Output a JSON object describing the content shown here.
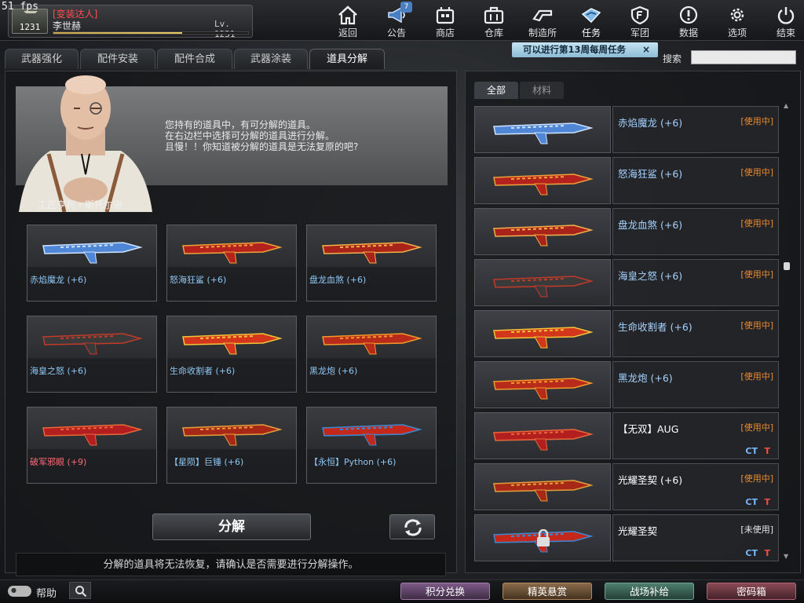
{
  "fps": "51 fps",
  "profile": {
    "rank": "1231",
    "title": "[变装达人]",
    "name": "李世赫",
    "level": "Lv. 1231",
    "xp_fraction": 0.66
  },
  "nav": [
    {
      "label": "返回",
      "icon": "home-icon"
    },
    {
      "label": "公告",
      "icon": "megaphone-icon",
      "badge": "7"
    },
    {
      "label": "商店",
      "icon": "shop-icon"
    },
    {
      "label": "仓库",
      "icon": "briefcase-icon"
    },
    {
      "label": "制造所",
      "icon": "wrench-icon"
    },
    {
      "label": "任务",
      "icon": "mission-icon"
    },
    {
      "label": "军团",
      "icon": "shield-icon"
    },
    {
      "label": "数据",
      "icon": "info-icon"
    },
    {
      "label": "选项",
      "icon": "gear-icon"
    },
    {
      "label": "结束",
      "icon": "power-icon"
    }
  ],
  "weekly_notice": "可以进行第13周每周任务",
  "weekly_close": "×",
  "search_label": "搜索",
  "search_value": "",
  "tabs": [
    "武器强化",
    "配件安装",
    "配件合成",
    "武器涂装",
    "道具分解"
  ],
  "npc": {
    "name": "工匠亨利・斯托尔诺",
    "lines": [
      "您持有的道具中，有可分解的道具。",
      "在右边栏中选择可分解的道具进行分解。",
      "且慢！！你知道被分解的道具是无法复原的吧?"
    ]
  },
  "selected_items": [
    {
      "name": "赤焰魔龙 (+6)",
      "color": "#8fc7f3"
    },
    {
      "name": "怒海狂鲨 (+6)",
      "color": "#8fc7f3"
    },
    {
      "name": "盘龙血煞 (+6)",
      "color": "#8fc7f3"
    },
    {
      "name": "海皇之怒 (+6)",
      "color": "#8fc7f3"
    },
    {
      "name": "生命收割者 (+6)",
      "color": "#8fc7f3"
    },
    {
      "name": "黑龙炮 (+6)",
      "color": "#8fc7f3"
    },
    {
      "name": "破军邪眼 (+9)",
      "color": "#ff6a7a"
    },
    {
      "name": "【星陨】巨锤 (+6)",
      "color": "#8fc7f3"
    },
    {
      "name": "【永恒】Python (+6)",
      "color": "#8fc7f3"
    }
  ],
  "decompose_label": "分解",
  "warning": "分解的道具将无法恢复，请确认是否需要进行分解操作。",
  "right_tabs": [
    "全部",
    "材料"
  ],
  "inventory": [
    {
      "name": "赤焰魔龙 (+6)",
      "status": "[使用中]"
    },
    {
      "name": "怒海狂鲨 (+6)",
      "status": "[使用中]"
    },
    {
      "name": "盘龙血煞 (+6)",
      "status": "[使用中]"
    },
    {
      "name": "海皇之怒 (+6)",
      "status": "[使用中]"
    },
    {
      "name": "生命收割者 (+6)",
      "status": "[使用中]"
    },
    {
      "name": "黑龙炮 (+6)",
      "status": "[使用中]"
    },
    {
      "name": "【无双】AUG",
      "status": "[使用中]",
      "ct": "CT",
      "t": "T"
    },
    {
      "name": "光耀圣契 (+6)",
      "status": "[使用中]",
      "ct": "CT",
      "t": "T"
    },
    {
      "name": "光耀圣契",
      "status": "[未使用]",
      "ct": "CT",
      "t": "T"
    }
  ],
  "help_label": "帮助",
  "bottom_buttons": [
    "积分兑换",
    "精英悬赏",
    "战场补给",
    "密码箱"
  ],
  "colors": {
    "accent_blue": "#8fc7f3",
    "status_orange": "#f08a2a",
    "rare_red": "#ff6a7a",
    "ct_blue": "#7ab8ff",
    "t_red": "#ff4a4a"
  }
}
